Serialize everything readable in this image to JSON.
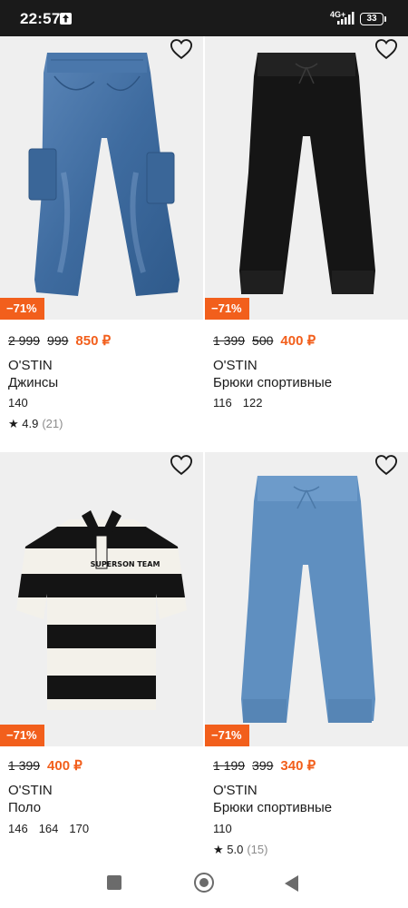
{
  "status_bar": {
    "time": "22:57",
    "network": "4G+",
    "battery": "33"
  },
  "products": [
    {
      "old_price": "2 999",
      "mid_price": "999",
      "price": "850 ₽",
      "discount": "−71%",
      "brand": "O'STIN",
      "name": "Джинсы",
      "sizes": [
        "140"
      ],
      "rating": "★ 4.9",
      "reviews": "(21)"
    },
    {
      "old_price": "1 399",
      "mid_price": "500",
      "price": "400 ₽",
      "discount": "−71%",
      "brand": "O'STIN",
      "name": "Брюки спортивные",
      "sizes": [
        "116",
        "122"
      ]
    },
    {
      "old_price": "1 399",
      "price": "400 ₽",
      "discount": "−71%",
      "brand": "O'STIN",
      "name": "Поло",
      "sizes": [
        "146",
        "164",
        "170"
      ],
      "print": "SUPERSON TEAM"
    },
    {
      "old_price": "1 199",
      "mid_price": "399",
      "price": "340 ₽",
      "discount": "−71%",
      "brand": "O'STIN",
      "name": "Брюки спортивные",
      "sizes": [
        "110"
      ],
      "rating": "★ 5.0",
      "reviews": "(15)"
    }
  ],
  "icons": {
    "favorite": "heart-outline-icon",
    "nav_recent": "square-icon",
    "nav_home": "circle-icon",
    "nav_back": "triangle-back-icon"
  },
  "colors": {
    "accent": "#f25f1c",
    "status_bar": "#1a1a1a"
  }
}
